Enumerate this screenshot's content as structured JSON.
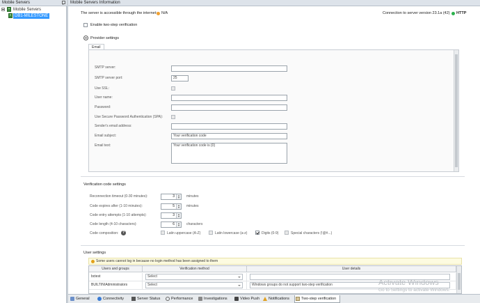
{
  "panes": {
    "left_title": "Mobile Servers",
    "right_title": "Mobile Servers Information"
  },
  "tree": {
    "root_label": "Mobile Servers",
    "child_label": "DB1-MILESTONE"
  },
  "header": {
    "internet_status_label": "The server is accessible through the internet:",
    "internet_status_value": "N/A",
    "internet_status_color": "#f0a030",
    "connection_label": "Connection to server version 23.1a (42)",
    "protocol_value": "HTTP",
    "protocol_color": "#2bb24c"
  },
  "two_step": {
    "enable_label": "Enable two-step verification",
    "enabled": false
  },
  "provider": {
    "title": "Provider settings",
    "tab_label": "Email",
    "fields": {
      "smtp_server_label": "SMTP server:",
      "smtp_server_value": "",
      "smtp_port_label": "SMTP server port:",
      "smtp_port_value": "25",
      "use_ssl_label": "Use SSL:",
      "user_name_label": "User name:",
      "user_name_value": "",
      "password_label": "Password:",
      "password_value": "",
      "spa_label": "Use Secure Password Authentication (SPA):",
      "sender_label": "Sender's email address:",
      "sender_value": "",
      "subject_label": "Email subject:",
      "subject_value": "Your verification code",
      "text_label": "Email text:",
      "text_value": "Your verification code is {0}"
    }
  },
  "verification": {
    "title": "Verification code settings",
    "reconnection_label": "Reconnection timeout (0-30 minutes):",
    "reconnection_value": "3",
    "reconnection_unit": "minutes",
    "expire_label": "Code expires after (1-10 minutes):",
    "expire_value": "5",
    "expire_unit": "minutes",
    "attempts_label": "Code entry attempts (1-10 attempts):",
    "attempts_value": "3",
    "length_label": "Code length (4-10 characters):",
    "length_value": "6",
    "length_unit": "characters",
    "composition_label": "Code composition:",
    "help_glyph": "?",
    "latin_upper_label": "Latin uppercase (A-Z)",
    "latin_lower_label": "Latin lowercase (a-z)",
    "digits_label": "Digits (0-9)",
    "special_label": "Special characters (!@#...)"
  },
  "user_settings": {
    "title": "User settings",
    "warning": "Some users cannot log in because no login method has been assigned to them",
    "columns": [
      "Users and groups",
      "Verification method",
      "User details"
    ],
    "rows": [
      {
        "user": "bctest",
        "method": "Select",
        "details": ""
      },
      {
        "user": "BUILTIN\\Administrators",
        "method": "Select",
        "details": "Windows groups do not support two-step verification"
      }
    ]
  },
  "tabs": [
    "General",
    "Connectivity",
    "Server Status",
    "Performance",
    "Investigations",
    "Video Push",
    "Notifications",
    "Two-step verification"
  ],
  "watermark": {
    "title": "Activate Windows",
    "subtitle": "Go to Settings to activate Windows."
  }
}
